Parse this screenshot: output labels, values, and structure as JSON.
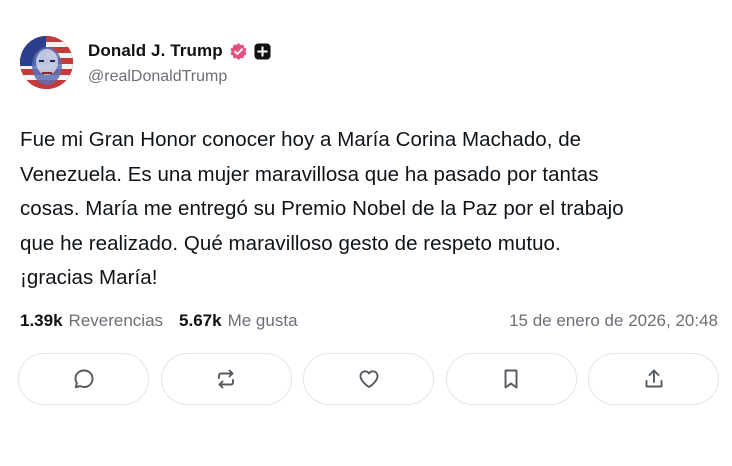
{
  "post": {
    "author": {
      "display_name": "Donald J. Trump",
      "handle": "@realDonaldTrump",
      "verified_badge_color": "#e2507e"
    },
    "text_lines": [
      "Fue mi Gran Honor conocer hoy a María Corina Machado, de",
      "Venezuela. Es una mujer maravillosa que ha pasado por tantas",
      "cosas. María me entregó su Premio Nobel de la Paz por el trabajo",
      "que he realizado. Qué maravilloso gesto de respeto mutuo.",
      "¡gracias María!"
    ],
    "stats": {
      "reposts_count": "1.39k",
      "reposts_label": "Reverencias",
      "likes_count": "5.67k",
      "likes_label": "Me gusta",
      "timestamp": "15 de enero de 2026, 20:48"
    },
    "actions": [
      {
        "icon": "reply-icon"
      },
      {
        "icon": "repost-icon"
      },
      {
        "icon": "heart-icon"
      },
      {
        "icon": "bookmark-icon"
      },
      {
        "icon": "share-icon"
      }
    ]
  },
  "colors": {
    "text_primary": "#0f1419",
    "text_secondary": "#6b6f76",
    "button_border": "#e3e5e8",
    "icon_stroke": "#555a61"
  }
}
